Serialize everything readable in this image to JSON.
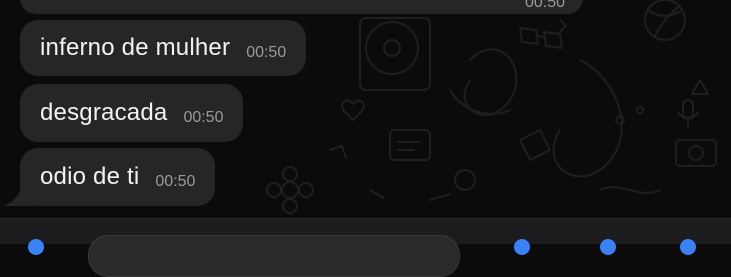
{
  "messages": [
    {
      "text": "",
      "time": "00:50"
    },
    {
      "text": "inferno de mulher",
      "time": "00:50"
    },
    {
      "text": "desgracada",
      "time": "00:50"
    },
    {
      "text": "odio de ti",
      "time": "00:50"
    }
  ],
  "colors": {
    "background": "#0b0b0c",
    "bubble": "#262628",
    "text": "#f2f2f4",
    "time": "#9a9a9e",
    "accent": "#3a82f7"
  }
}
